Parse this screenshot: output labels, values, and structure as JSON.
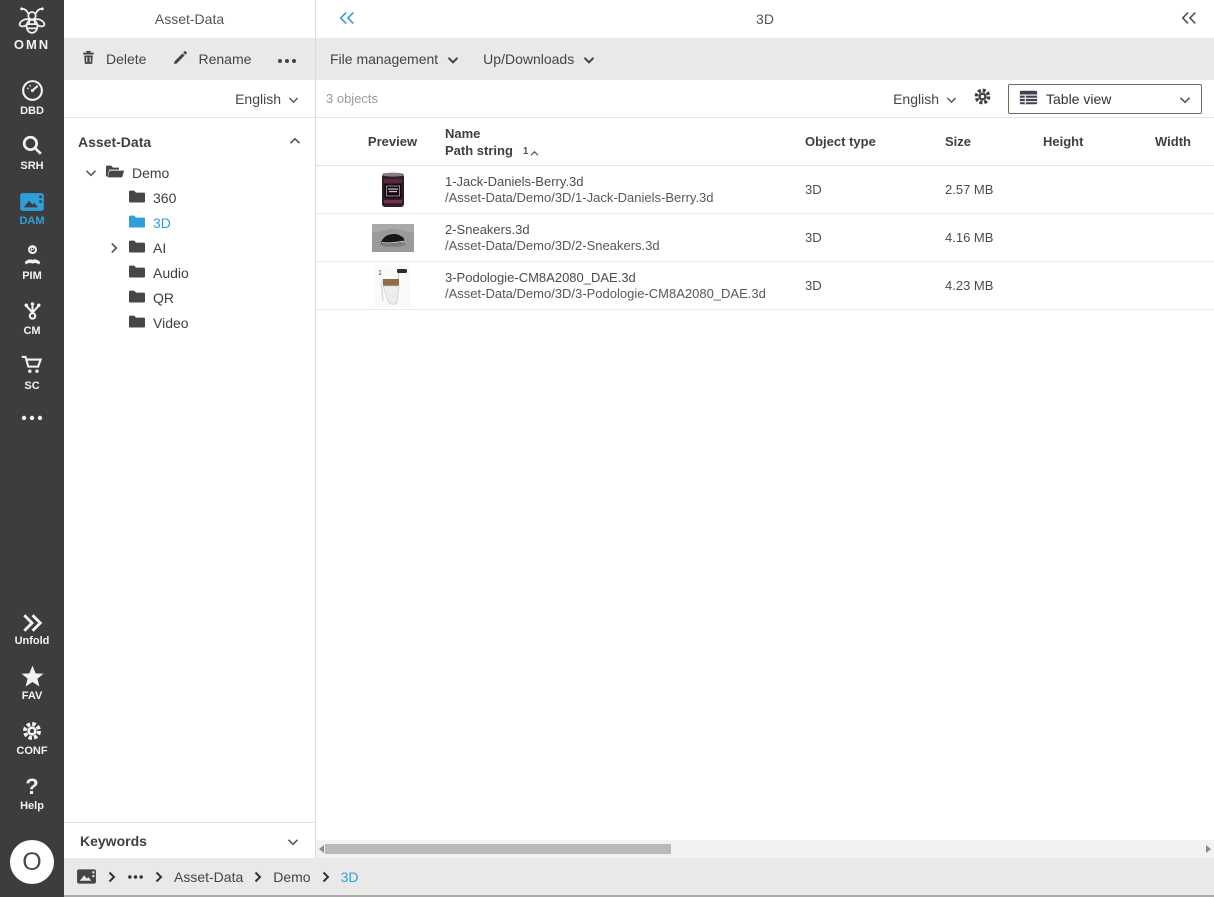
{
  "colors": {
    "accent": "#2f9fd9",
    "rail_bg": "#3d3d3d",
    "toolbar_bg": "#e9e9e9"
  },
  "rail": {
    "logo_label": "OMN",
    "items": [
      {
        "id": "dbd",
        "label": "DBD",
        "icon": "dashboard-icon",
        "active": false
      },
      {
        "id": "srh",
        "label": "SRH",
        "icon": "search-icon",
        "active": false
      },
      {
        "id": "dam",
        "label": "DAM",
        "icon": "image-icon",
        "active": true
      },
      {
        "id": "pim",
        "label": "PIM",
        "icon": "person-icon",
        "active": false
      },
      {
        "id": "cm",
        "label": "CM",
        "icon": "share-icon",
        "active": false
      },
      {
        "id": "sc",
        "label": "SC",
        "icon": "cart-icon",
        "active": false
      }
    ],
    "more_icon": "ellipsis-icon",
    "unfold_label": "Unfold",
    "fav_label": "FAV",
    "conf_label": "CONF",
    "help_label": "Help",
    "avatar_letter": "O"
  },
  "explorer": {
    "title": "Asset-Data",
    "delete_label": "Delete",
    "rename_label": "Rename",
    "language": "English",
    "tree_root": "Asset-Data",
    "tree_nodes": [
      "Demo",
      "360",
      "3D",
      "AI",
      "Audio",
      "QR",
      "Video"
    ],
    "selected_node": "3D",
    "keywords_label": "Keywords"
  },
  "main": {
    "title": "3D",
    "file_management_label": "File management",
    "updownloads_label": "Up/Downloads",
    "objects_count": "3 objects",
    "language": "English",
    "view_select_label": "Table view",
    "table": {
      "headers": {
        "preview": "Preview",
        "name": "Name",
        "path": "Path string",
        "sort_order": "1",
        "object_type": "Object type",
        "size": "Size",
        "height": "Height",
        "width": "Width"
      },
      "rows": [
        {
          "name": "1-Jack-Daniels-Berry.3d",
          "path": "/Asset-Data/Demo/3D/1-Jack-Daniels-Berry.3d",
          "type": "3D",
          "size": "2.57 MB",
          "height": "",
          "width": ""
        },
        {
          "name": "2-Sneakers.3d",
          "path": "/Asset-Data/Demo/3D/2-Sneakers.3d",
          "type": "3D",
          "size": "4.16 MB",
          "height": "",
          "width": ""
        },
        {
          "name": "3-Podologie-CM8A2080_DAE.3d",
          "path": "/Asset-Data/Demo/3D/3-Podologie-CM8A2080_DAE.3d",
          "type": "3D",
          "size": "4.23 MB",
          "height": "",
          "width": ""
        }
      ]
    }
  },
  "breadcrumb": {
    "items": [
      "Asset-Data",
      "Demo",
      "3D"
    ]
  }
}
